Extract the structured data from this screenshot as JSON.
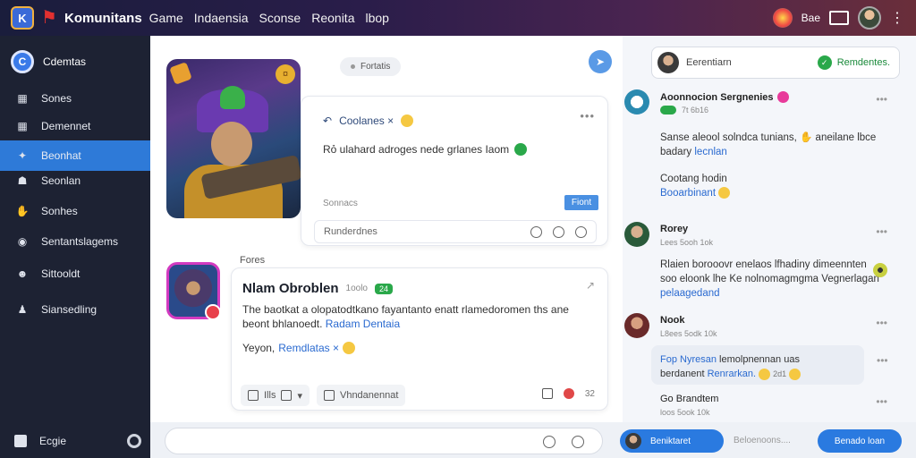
{
  "topbar": {
    "brand": "Komunitans",
    "nav": [
      "Game",
      "Indaensia",
      "Sconse",
      "Reonita",
      "lbop"
    ],
    "right_text": "Bae"
  },
  "sidebar": {
    "profile_label": "Cdemtas",
    "items": [
      {
        "label": "Sones",
        "icon": "grid-icon"
      },
      {
        "label": "Demennet",
        "icon": "grid-icon"
      },
      {
        "label": "Beonhat",
        "icon": "bird-icon"
      },
      {
        "label": "Seonlan",
        "icon": "people-icon"
      },
      {
        "label": "Sonhes",
        "icon": "hand-icon"
      },
      {
        "label": "Sentantslagems",
        "icon": "globe-icon"
      },
      {
        "label": "Sittooldt",
        "icon": "user-icon"
      },
      {
        "label": "Siansedling",
        "icon": "person-icon"
      }
    ],
    "footer_label": "Ecgie"
  },
  "main": {
    "pill": "Fortatis",
    "post1": {
      "title": "Coolanes ×",
      "body": "Rỏ ulahard adroges nede grlanes Iaom",
      "meta_left": "Sonnacs",
      "button": "Fiont",
      "footer": "Runderdnes"
    },
    "section_label": "Fores",
    "post2": {
      "name": "Nlam Obroblen",
      "time": "1oolo",
      "tag": "24",
      "text": "The baotkat a olopatodtkano fayantanto enatt rlamedoromen ths ane beont bhlanoedt.",
      "text_link": "Radam Dentaia",
      "line3_prefix": "Yeyon,",
      "line3_link": "Remdlatas ×",
      "actions": [
        {
          "label": "Ills"
        },
        {
          "label": ""
        },
        {
          "label": "Vhndanennat"
        }
      ],
      "count": "32"
    }
  },
  "right": {
    "search_text": "Eerentiarn",
    "search_button": "Remdentes.",
    "cards": [
      {
        "name": "Aoonnocion Sergnenies",
        "sub": "7t 6b16",
        "text": "Sanse aleool solndca tunians,",
        "text2": "aneilane lbce",
        "text3_plain": "badary",
        "text3_link": "lecnlan",
        "extra": "Cootang hodin",
        "extra_link": "Booarbinant"
      },
      {
        "name": "Rorey",
        "sub": "Lees 5ooh 1ok",
        "text": "Rlaien borooovr enelaos lfhadiny dimeennten",
        "text2": "soo eloonk lhe Ke nolnomagmgma Vegnerlagan",
        "text3_link": "pelaagedand"
      },
      {
        "name": "Nook",
        "sub": "L8ees 5odk 10k",
        "bubble_link": "Fop Nyresan",
        "bubble_text": "lemolpnennan uas",
        "bubble_prefix": "berdanent",
        "bubble_link2": "Renrarkan.",
        "bubble_count": "2d1"
      },
      {
        "name": "Go Brandtem",
        "sub": "loos 5ook 10k"
      }
    ],
    "composer_button": "Beniktaret",
    "composer_placeholder": "Beloenoons....",
    "post_button": "Benado loan"
  }
}
